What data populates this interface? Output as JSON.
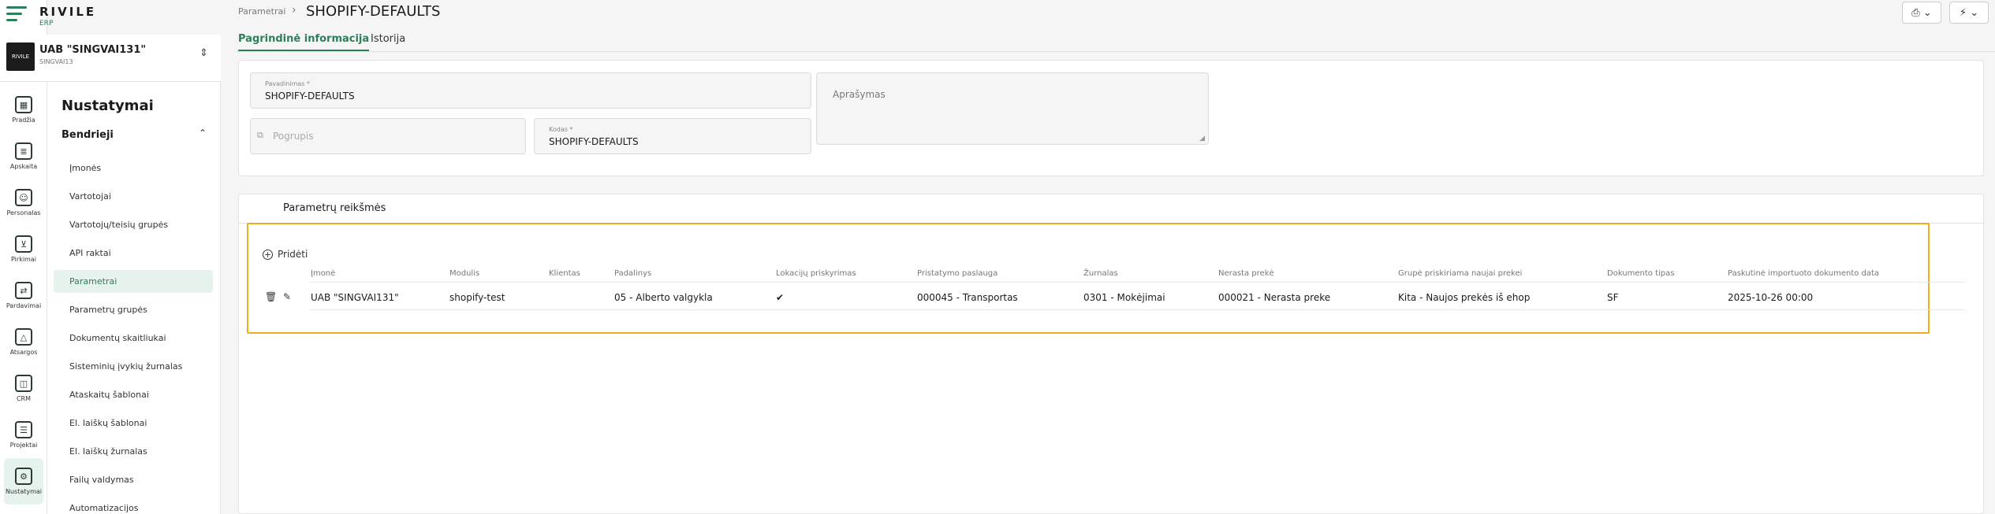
{
  "logo": {
    "brand": "RIVILE",
    "sub": "ERP"
  },
  "company": {
    "name": "UAB \"SINGVAI131\"",
    "code": "SINGVAI13",
    "logo_text": "RIVILE"
  },
  "rail": [
    {
      "label": "Pradžia",
      "icon": "dashboard-icon"
    },
    {
      "label": "Apskaita",
      "icon": "accounting-icon"
    },
    {
      "label": "Personalas",
      "icon": "people-icon"
    },
    {
      "label": "Pirkimai",
      "icon": "cart-icon"
    },
    {
      "label": "Pardavimai",
      "icon": "sales-icon"
    },
    {
      "label": "Atsargos",
      "icon": "inventory-icon"
    },
    {
      "label": "CRM",
      "icon": "crm-icon"
    },
    {
      "label": "Projektai",
      "icon": "projects-icon"
    },
    {
      "label": "Nustatymai",
      "icon": "settings-gear-icon"
    }
  ],
  "menu": {
    "title": "Nustatymai",
    "section": "Bendrieji",
    "items": [
      "Įmonės",
      "Vartotojai",
      "Vartotojų/teisių grupės",
      "API raktai",
      "Parametrai",
      "Parametrų grupės",
      "Dokumentų skaitliukai",
      "Sisteminių įvykių žurnalas",
      "Ataskaitų šablonai",
      "El. laiškų šablonai",
      "El. laiškų žurnalas",
      "Failų valdymas",
      "Automatizacijos"
    ],
    "active_index": 4
  },
  "breadcrumb": {
    "parent": "Parametrai",
    "current": "SHOPIFY-DEFAULTS"
  },
  "tabs": [
    "Pagrindinė informacija",
    "Istorija"
  ],
  "form": {
    "name_label": "Pavadinimas *",
    "name_value": "SHOPIFY-DEFAULTS",
    "group_placeholder": "Pogrupis",
    "code_label": "Kodas *",
    "code_value": "SHOPIFY-DEFAULTS",
    "description_placeholder": "Aprašymas"
  },
  "params": {
    "title": "Parametrų reikšmės",
    "add_label": "Pridėti",
    "columns": [
      "Įmonė",
      "Modulis",
      "Klientas",
      "Padalinys",
      "Lokacijų priskyrimas",
      "Pristatymo paslauga",
      "Žurnalas",
      "Nerasta prekė",
      "Grupė priskiriama naujai prekei",
      "Dokumento tipas",
      "Paskutinė importuoto dokumento data"
    ],
    "row": {
      "company": "UAB \"SINGVAI131\"",
      "module": "shopify-test",
      "client": "",
      "department": "05 - Alberto valgykla",
      "location": "✔",
      "delivery": "000045 - Transportas",
      "journal": "0301 - Mokėjimai",
      "missing": "000021 - Nerasta preke",
      "group": "Kita - Naujos prekės iš ehop",
      "doctype": "SF",
      "lastdate": "2025-10-26 00:00"
    }
  }
}
